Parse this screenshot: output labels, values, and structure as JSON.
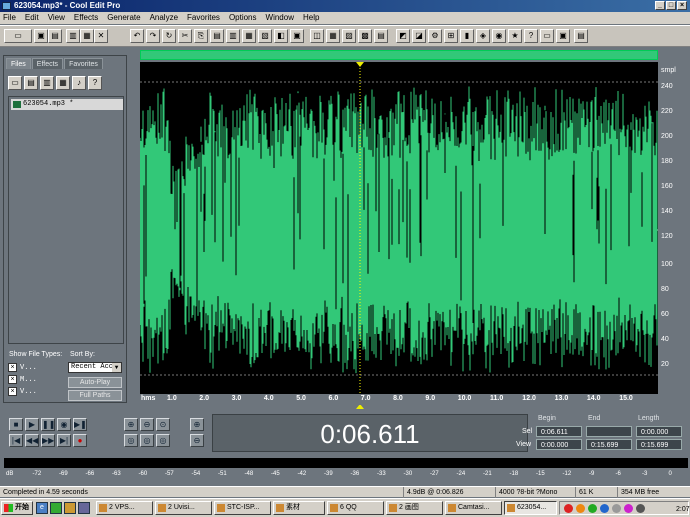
{
  "window": {
    "title": "623054.mp3* - Cool Edit Pro"
  },
  "menu": [
    "File",
    "Edit",
    "View",
    "Effects",
    "Generate",
    "Analyze",
    "Favorites",
    "Options",
    "Window",
    "Help"
  ],
  "toolbar_icons": [
    "multitrack-icon",
    "new-icon",
    "open-icon",
    "save-icon",
    "saveas-icon",
    "close-icon",
    "undo-icon",
    "redo-icon",
    "repeat-icon",
    "cut-icon",
    "copy-icon",
    "paste-icon",
    "paste-new-icon",
    "mix-paste-icon",
    "trim-icon",
    "zoom-sel-icon",
    "select-icon",
    "envelope-icon",
    "spectral-icon",
    "edit-icon",
    "draw-icon",
    "fft-icon",
    "waveform-icon",
    "scrub-icon",
    "settings-icon",
    "snap-icon",
    "marker-icon",
    "cue-icon",
    "pitch-icon",
    "favorite-icon",
    "help-icon"
  ],
  "left_panel": {
    "tabs": [
      "Files",
      "Effects",
      "Favorites"
    ],
    "files": [
      {
        "name": "623054.mp3 *"
      }
    ],
    "show_file_types_label": "Show File Types:",
    "sort_by_label": "Sort By:",
    "file_types": [
      "V...",
      "M...",
      "V..."
    ],
    "sort_value": "Recent Acc",
    "auto_play_label": "Auto-Play",
    "full_paths_label": "Full Paths"
  },
  "waveform": {
    "ruler_unit": "hms",
    "ruler_ticks": [
      "1.0",
      "2.0",
      "3.0",
      "4.0",
      "5.0",
      "6.0",
      "7.0",
      "8.0",
      "9.0",
      "10.0",
      "11.0",
      "12.0",
      "13.0",
      "14.0",
      "15.0"
    ],
    "scale_unit": "smpl",
    "scale_ticks_top": [
      "240",
      "220",
      "200",
      "180",
      "160",
      "140",
      "120"
    ],
    "scale_ticks_bottom": [
      "100",
      "80",
      "60",
      "40",
      "20"
    ]
  },
  "time_display": "0:06.611",
  "selection_view": {
    "headers": {
      "begin": "Begin",
      "end": "End",
      "length": "Length"
    },
    "sel_label": "Sel",
    "view_label": "View",
    "sel": {
      "begin": "0:06.611",
      "end": "",
      "length": "0:00.000"
    },
    "view": {
      "begin": "0:00.000",
      "end": "0:15.699",
      "length": "0:15.699"
    }
  },
  "meter": {
    "ticks": [
      "dB",
      "-72",
      "-69",
      "-66",
      "-63",
      "-60",
      "-57",
      "-54",
      "-51",
      "-48",
      "-45",
      "-42",
      "-39",
      "-36",
      "-33",
      "-30",
      "-27",
      "-24",
      "-21",
      "-18",
      "-15",
      "-12",
      "-9",
      "-6",
      "-3",
      "0"
    ]
  },
  "status": {
    "left": "Completed in 4.59 seconds",
    "level": "4.9dB @ 0:06.826",
    "format": "4000 ?8-bit ?Mono",
    "size": "61 K",
    "free": "354 MB free"
  },
  "taskbar": {
    "start": "开始",
    "tasks": [
      {
        "label": "2 VPS..."
      },
      {
        "label": "2 Uvisi..."
      },
      {
        "label": "STC-ISP..."
      },
      {
        "label": "素材"
      },
      {
        "label": "6 QQ"
      },
      {
        "label": "2 画图"
      },
      {
        "label": "Camtasi..."
      },
      {
        "label": "623054..."
      }
    ],
    "clock": "2:07"
  },
  "colors": {
    "wave": "#32c878",
    "wave_bg": "#000000",
    "panel": "#6d757d"
  }
}
